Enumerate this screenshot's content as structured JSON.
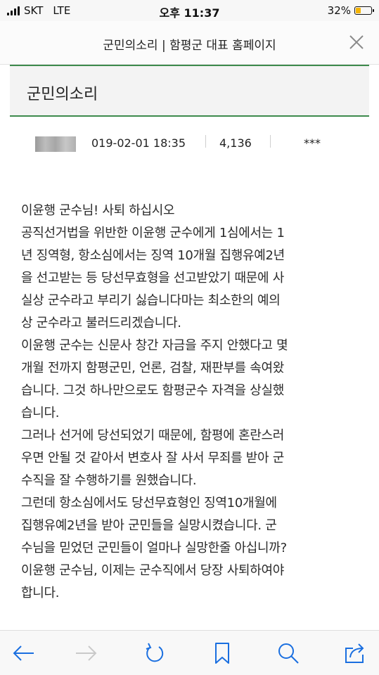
{
  "status_bar": {
    "carrier": "SKT",
    "network": "LTE",
    "time": "오후 11:37",
    "battery_percent": "32%",
    "battery_level": 0.32,
    "battery_color": "#f5b400"
  },
  "browser": {
    "page_title": "군민의소리 | 함평군 대표 홈페이지",
    "close_icon": "close-icon"
  },
  "board": {
    "title": "군민의소리",
    "accent_color": "#3d8a4c"
  },
  "post_meta": {
    "date": "019-02-01 18:35",
    "views": "4,136",
    "author": "***"
  },
  "article": {
    "lines": [
      "이윤행 군수님! 사퇴 하십시오",
      "공직선거법을 위반한 이윤행 군수에게 1심에서는 1",
      "년 징역형, 항소심에서는 징역 10개월 집행유예2년",
      "을 선고받는 등 당선무효형을 선고받았기 때문에 사",
      "실상 군수라고 부리기 싫습니다마는 최소한의 예의",
      "상 군수라고 불러드리겠습니다.",
      "이윤행 군수는 신문사 창간 자금을 주지 안했다고 몇",
      "개월 전까지 함평군민, 언론, 검찰, 재판부를 속여왔",
      "습니다. 그것 하나만으로도 함평군수 자격을 상실했",
      "습니다.",
      "그러나 선거에 당선되었기 때문에, 함평에 혼란스러",
      "우면 안될 것 같아서 변호사 잘 사서 무죄를 받아 군",
      "수직을 잘 수행하기를 원했습니다.",
      "그런데 항소심에서도 당선무효형인 징역10개월에",
      "집행유예2년을 받아 군민들을 실망시켰습니다. 군",
      "수님을 믿었던 군민들이 얼마나 실망한줄 아십니까?",
      "이윤행 군수님, 이제는 군수직에서 당장 사퇴하여야",
      "합니다."
    ]
  },
  "toolbar": {
    "items": [
      "back-arrow-icon",
      "forward-arrow-icon",
      "reload-icon",
      "bookmark-icon",
      "search-icon",
      "share-icon"
    ]
  }
}
